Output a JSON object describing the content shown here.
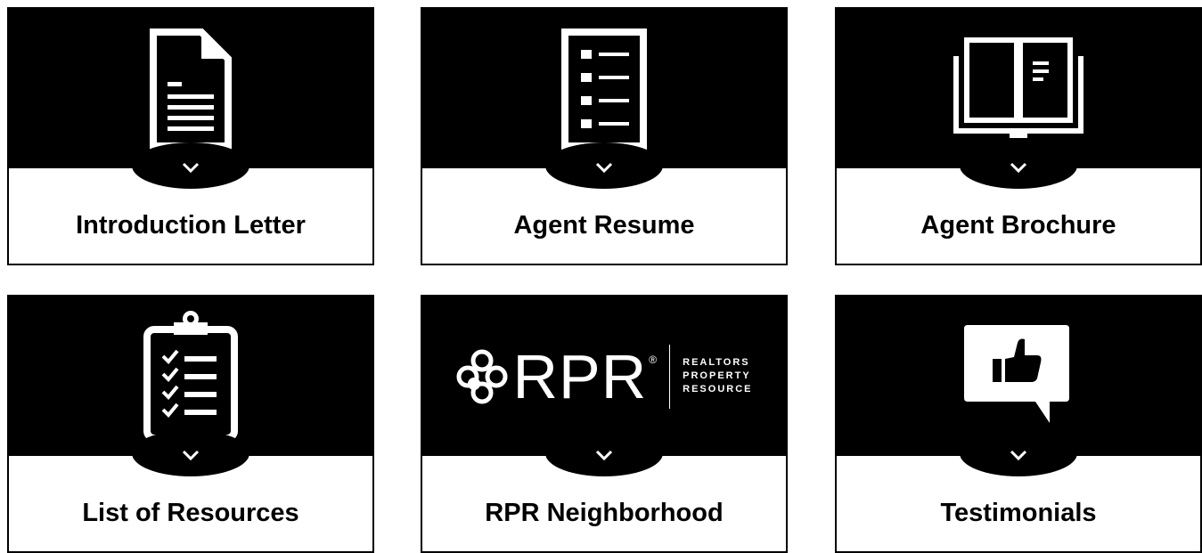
{
  "cards": [
    {
      "label": "Introduction Letter",
      "icon": "document-icon"
    },
    {
      "label": "Agent Resume",
      "icon": "checklist-document-icon"
    },
    {
      "label": "Agent Brochure",
      "icon": "open-book-icon"
    },
    {
      "label": "List of Resources",
      "icon": "clipboard-checklist-icon"
    },
    {
      "label": "RPR Neighborhood",
      "icon": "rpr-logo"
    },
    {
      "label": "Testimonials",
      "icon": "thumbs-up-speech-bubble-icon"
    }
  ],
  "rpr_logo": {
    "wordmark": "RPR",
    "registered": "®",
    "line1": "REALTORS",
    "line2": "PROPERTY",
    "line3": "RESOURCE"
  },
  "colors": {
    "card_background": "#000000",
    "icon": "#ffffff",
    "label_text": "#000000",
    "border": "#000000"
  }
}
